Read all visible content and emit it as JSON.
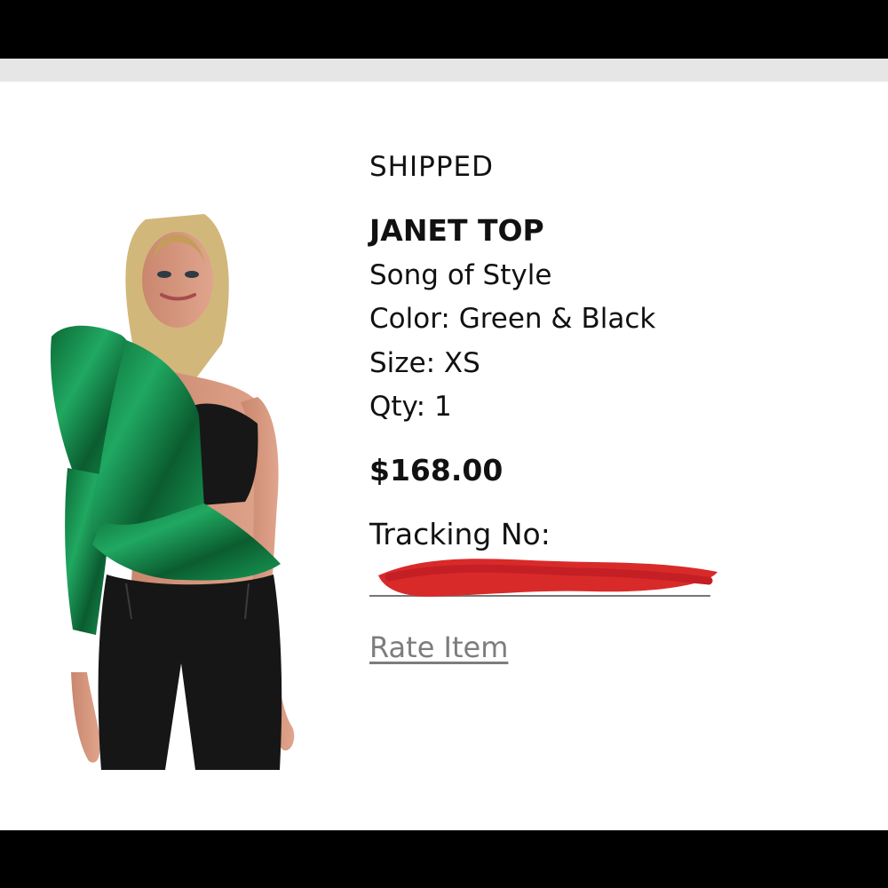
{
  "order_item": {
    "status": "SHIPPED",
    "name": "JANET TOP",
    "brand": "Song of Style",
    "color": "Color: Green & Black",
    "size": "Size: XS",
    "qty": "Qty: 1",
    "price": "$168.00",
    "tracking_label": "Tracking No:",
    "rate_label": "Rate Item"
  },
  "colors": {
    "background": "#ffffff",
    "frame": "#000000",
    "top_bar": "#e6e6e6",
    "garment_green": "#16884b",
    "redaction": "#d92a2a",
    "link_gray": "#7d7d7d"
  },
  "icons": {
    "product_image": "model-wearing-green-one-shoulder-top"
  }
}
